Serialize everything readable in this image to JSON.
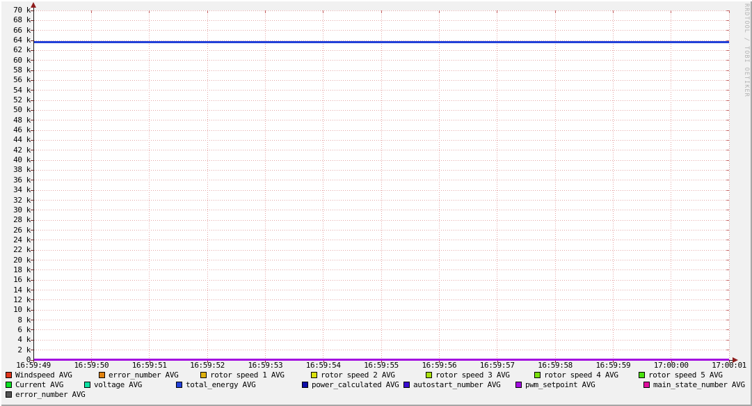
{
  "watermark": "RRDTOOL / TOBI OETIKER",
  "colors": {
    "canvas": "#f1f1f1",
    "plot_background": "#ffffff",
    "grid": "#e4a3a3",
    "grid_end": "#c46262",
    "axis": "#161616",
    "arrow": "#8e1d1d",
    "tick": "#7d2b2b",
    "watermark": "#b4b4b4",
    "zero_line_visible": "#a30de0",
    "main_line_visible": "#2341d9"
  },
  "chart_data": {
    "type": "line",
    "title": "",
    "xlabel": "",
    "ylabel": "",
    "grid": true,
    "ylim": [
      0,
      70000
    ],
    "y_step": 2000,
    "y_tick_labels": [
      "0",
      "2 k",
      "4 k",
      "6 k",
      "8 k",
      "10 k",
      "12 k",
      "14 k",
      "16 k",
      "18 k",
      "20 k",
      "22 k",
      "24 k",
      "26 k",
      "28 k",
      "30 k",
      "32 k",
      "34 k",
      "36 k",
      "38 k",
      "40 k",
      "42 k",
      "44 k",
      "46 k",
      "48 k",
      "50 k",
      "52 k",
      "54 k",
      "56 k",
      "58 k",
      "60 k",
      "62 k",
      "64 k",
      "66 k",
      "68 k",
      "70 k"
    ],
    "x_tick_labels": [
      "16:59:49",
      "16:59:50",
      "16:59:51",
      "16:59:52",
      "16:59:53",
      "16:59:54",
      "16:59:55",
      "16:59:56",
      "16:59:57",
      "16:59:58",
      "16:59:59",
      "17:00:00",
      "17:00:01"
    ],
    "series": [
      {
        "name": "Windspeed AVG",
        "color": "#e0341b",
        "value": 0
      },
      {
        "name": "error_number AVG",
        "color": "#e0820f",
        "value": 0
      },
      {
        "name": "rotor speed 1 AVG",
        "color": "#dfb10d",
        "value": 0
      },
      {
        "name": "rotor speed 2 AVG",
        "color": "#d9e00d",
        "value": 0
      },
      {
        "name": "rotor speed 3 AVG",
        "color": "#a8e00d",
        "value": 0
      },
      {
        "name": "rotor speed 4 AVG",
        "color": "#79e00d",
        "value": 0
      },
      {
        "name": "rotor speed 5 AVG",
        "color": "#49e00d",
        "value": 0
      },
      {
        "name": "Current AVG",
        "color": "#0de023",
        "value": 0
      },
      {
        "name": "voltage AVG",
        "color": "#0de0a2",
        "value": 0
      },
      {
        "name": "power_calculated AVG",
        "color": "#0d0da8",
        "value": 0
      },
      {
        "name": "autostart_number AVG",
        "color": "#3a0dd0",
        "value": 0
      },
      {
        "name": "main_state_number AVG",
        "color": "#e00d9e",
        "value": 0
      },
      {
        "name": "error_number AVG",
        "color": "#555555",
        "value": 0
      },
      {
        "name": "pwm_setpoint AVG",
        "color": "#a30de0",
        "value": 0
      },
      {
        "name": "total_energy AVG",
        "color": "#2341d9",
        "value": 63600
      }
    ]
  },
  "legend": {
    "rows": [
      [
        {
          "label": "Windspeed AVG",
          "color": "#e0341b"
        },
        {
          "label": "error_number AVG",
          "color": "#e0820f"
        },
        {
          "label": "rotor speed 1 AVG",
          "color": "#dfb10d"
        },
        {
          "label": "rotor speed 2 AVG",
          "color": "#d9e00d"
        },
        {
          "label": "rotor speed 3 AVG",
          "color": "#a8e00d"
        },
        {
          "label": "rotor speed 4 AVG",
          "color": "#79e00d"
        },
        {
          "label": "rotor speed 5 AVG",
          "color": "#49e00d"
        }
      ],
      [
        {
          "label": "Current AVG",
          "color": "#0de023"
        },
        {
          "label": "voltage AVG",
          "color": "#0de0a2"
        },
        {
          "label": "total_energy AVG",
          "color": "#2341d9"
        },
        {
          "label": "power_calculated AVG",
          "color": "#0d0da8"
        },
        {
          "label": "autostart_number AVG",
          "color": "#3a0dd0"
        },
        {
          "label": "pwm_setpoint AVG",
          "color": "#a30de0"
        },
        {
          "label": "main_state_number AVG",
          "color": "#e00d9e"
        }
      ],
      [
        {
          "label": "error_number AVG",
          "color": "#555555"
        }
      ]
    ]
  }
}
